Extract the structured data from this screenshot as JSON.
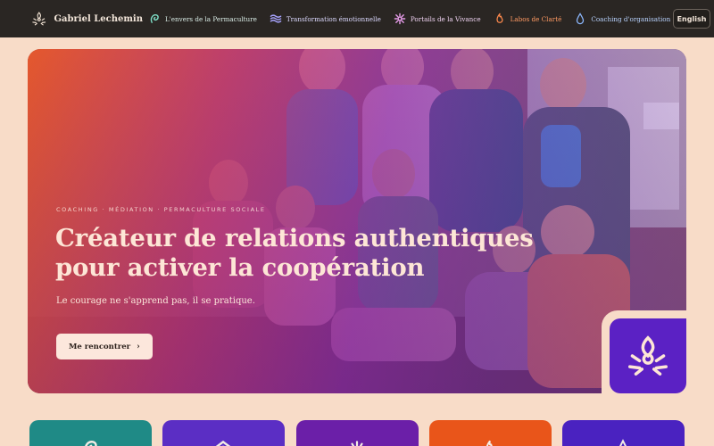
{
  "brand": {
    "name": "Gabriel Lechemin",
    "logo_icon": "campfire-icon",
    "logo_color": "#f1e2d3"
  },
  "nav": {
    "items": [
      {
        "label": "L'envers de la Permaculture",
        "icon": "spiral-leaf-icon",
        "color": "#7ee0c8"
      },
      {
        "label": "Transformation émotionnelle",
        "icon": "waves-icon",
        "color": "#a8a4ff"
      },
      {
        "label": "Portails de la Vivance",
        "icon": "flower-icon",
        "color": "#e59be8"
      },
      {
        "label": "Labos de Clarté",
        "icon": "flame-icon",
        "color": "#ff8a4d"
      },
      {
        "label": "Coaching d'organisation",
        "icon": "drop-icon",
        "color": "#8cb8ff"
      }
    ]
  },
  "language": {
    "label": "English"
  },
  "hero": {
    "eyebrow": "COACHING · MÉDIATION · PERMACULTURE SOCIALE",
    "title": "Créateur de relations authentiques pour activer la coopération",
    "subtitle": "Le courage ne s'apprend pas, il se pratique.",
    "cta": {
      "label": "Me rencontrer",
      "arrow": "›"
    },
    "corner_logo": {
      "icon": "campfire-icon",
      "bg": "#5b21c4"
    }
  },
  "cards": [
    {
      "color": "#1f8a86",
      "icon": "spiral-leaf-icon"
    },
    {
      "color": "#5b2ec4",
      "icon": "waves-icon"
    },
    {
      "color": "#6b1fa8",
      "icon": "flower-icon"
    },
    {
      "color": "#e9551a",
      "icon": "flame-icon"
    },
    {
      "color": "#4a22c0",
      "icon": "drop-icon"
    }
  ],
  "colors": {
    "header_bg": "#2a2623",
    "page_bg": "#f8dcc8",
    "hero_text": "#fde6d6"
  }
}
